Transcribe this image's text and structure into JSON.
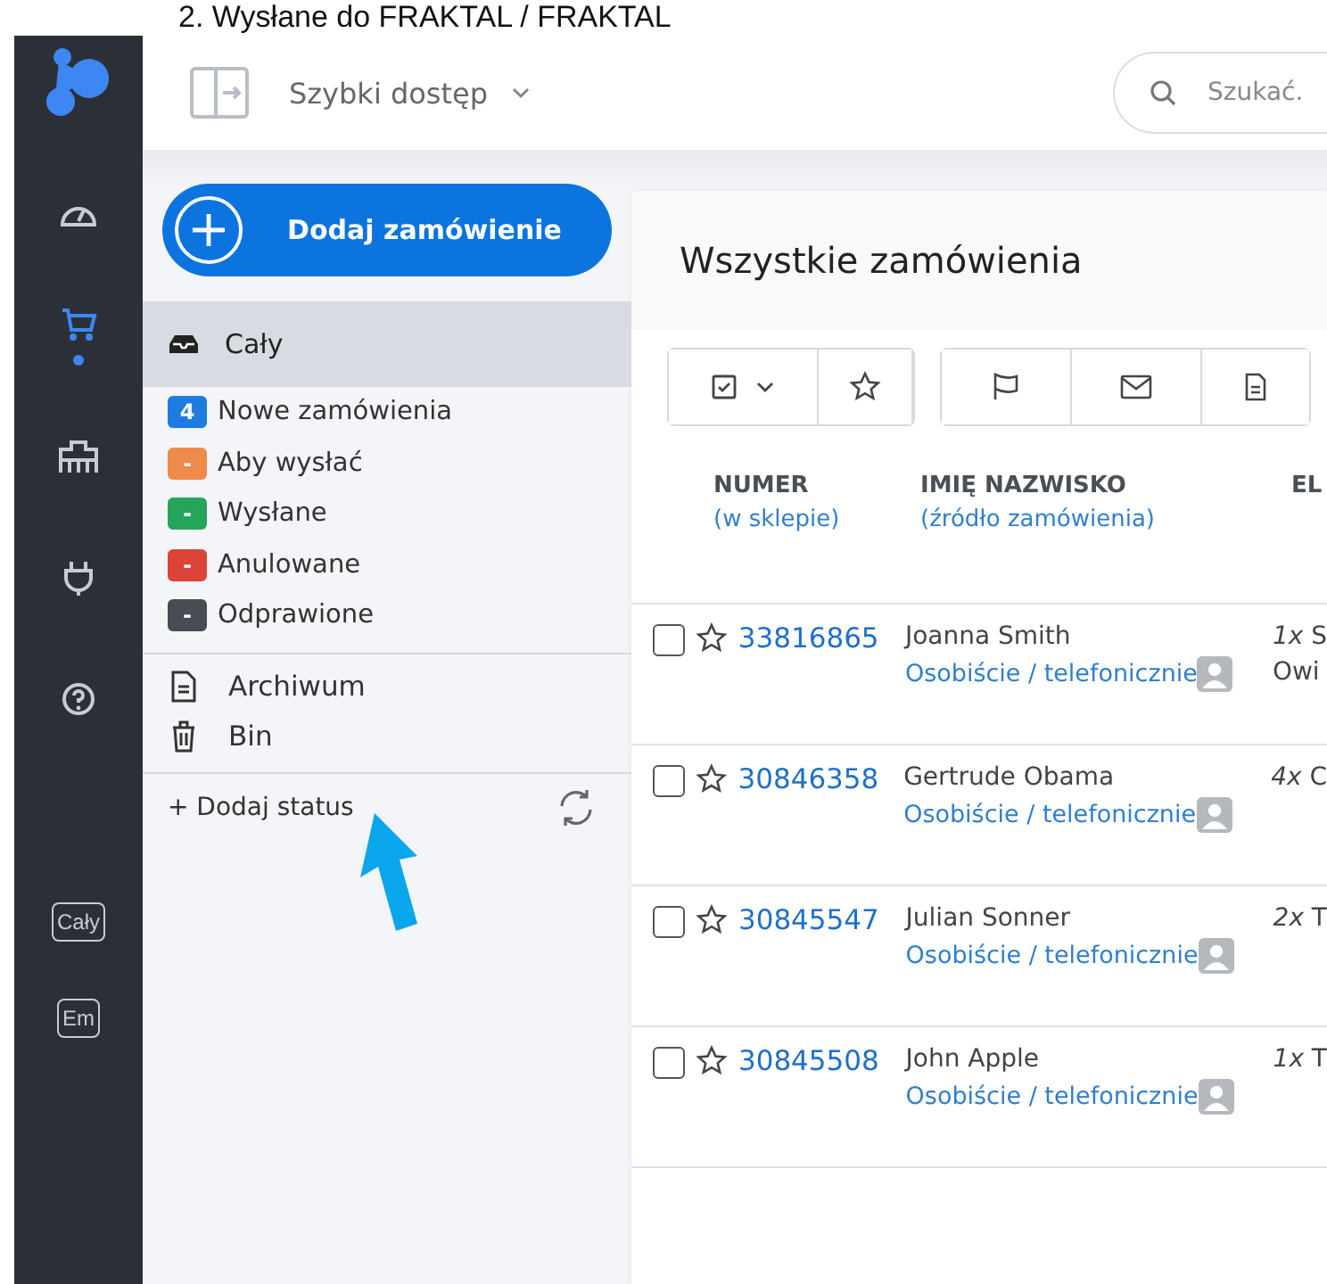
{
  "caption": "2. Wysłane do FRAKTAL / FRAKTAL",
  "rail": [
    {
      "kind": "dashboard",
      "selected": false
    },
    {
      "kind": "cart",
      "selected": true
    },
    {
      "kind": "warehouse",
      "selected": false
    },
    {
      "kind": "plug",
      "selected": false
    },
    {
      "kind": "help",
      "selected": false
    }
  ],
  "rail_badges": [
    "Cały",
    "Em"
  ],
  "header": {
    "quick_access": "Szybki dostęp",
    "search": {
      "placeholder": "Szukać."
    }
  },
  "sidebar": {
    "add_button": "Dodaj zamówienie",
    "all": {
      "label": "Cały",
      "selected": true
    },
    "statuses": [
      {
        "count": "4",
        "label": "Nowe zamówienia",
        "color": "#1e7ce0"
      },
      {
        "count": "-",
        "label": "Aby wysłać",
        "color": "#ee8a4a"
      },
      {
        "count": "-",
        "label": "Wysłane",
        "color": "#25a55a"
      },
      {
        "count": "-",
        "label": "Anulowane",
        "color": "#dc4437"
      },
      {
        "count": "-",
        "label": "Odprawione",
        "color": "#474c55"
      }
    ],
    "extra": [
      {
        "kind": "archive",
        "label": "Archiwum"
      },
      {
        "kind": "trash",
        "label": "Bin"
      }
    ],
    "add_status": "+ Dodaj status"
  },
  "main": {
    "title": "Wszystkie zamówienia",
    "columns": [
      {
        "title": "NUMER",
        "subtitle": "(w sklepie)"
      },
      {
        "title": "IMIĘ NAZWISKO",
        "subtitle": "(źródło zamówienia)"
      },
      {
        "title": "EL"
      }
    ],
    "rows": [
      {
        "checked": false,
        "starred": false,
        "number": "33816865",
        "name": "Joanna Smith",
        "source": "Osobiście / telefonicznie",
        "qty": "1x",
        "item": "S",
        "item_2": "Owi"
      },
      {
        "checked": false,
        "starred": false,
        "number": "30846358",
        "name": "Gertrude Obama",
        "source": "Osobiście / telefonicznie",
        "qty": "4x",
        "item": "C"
      },
      {
        "checked": false,
        "starred": false,
        "number": "30845547",
        "name": "Julian Sonner",
        "source": "Osobiście / telefonicznie",
        "qty": "2x",
        "item": "T"
      },
      {
        "checked": false,
        "starred": false,
        "number": "30845508",
        "name": "John Apple",
        "source": "Osobiście / telefonicznie",
        "qty": "1x",
        "item": "T"
      }
    ]
  }
}
